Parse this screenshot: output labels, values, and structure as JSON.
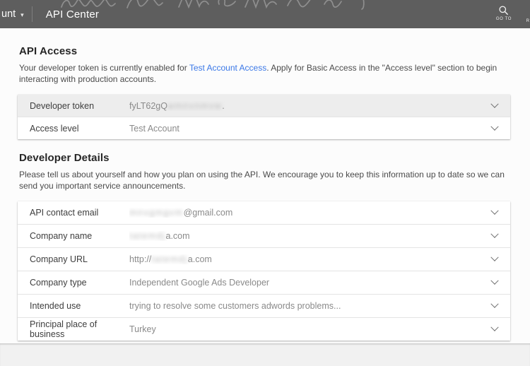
{
  "colors": {
    "header_bg": "#5e5e5e",
    "header_text": "#ffffff",
    "link_blue": "#3b78e7",
    "content_bg": "#fcfcfc",
    "footer_bg": "#f1f1f1",
    "shaded_row_bg": "#ededed",
    "row_bg": "#ffffff",
    "label_text": "#3e3e3e",
    "value_text": "#8a8a8a",
    "heading_text": "#262626",
    "body_text": "#4b4b4b"
  },
  "header": {
    "account_label": "unt",
    "caret_icon": "▾",
    "title": "API Center",
    "goto_label": "GO TO",
    "clipped_label": "R"
  },
  "sections": {
    "api_access": {
      "title": "API Access",
      "desc_before_link": "Your developer token is currently enabled for ",
      "desc_link": "Test Account Access",
      "desc_after_link": ". Apply for Basic Access in the \"Access level\" section to begin interacting with production accounts.",
      "rows": [
        {
          "label": "Developer token",
          "shaded": true,
          "parts": [
            {
              "text": "fyLT62gQ",
              "blur": false
            },
            {
              "text": "wmnvnmvw",
              "blur": true
            },
            {
              "text": ".",
              "blur": false
            }
          ]
        },
        {
          "label": "Access level",
          "shaded": false,
          "parts": [
            {
              "text": "Test Account",
              "blur": false
            }
          ]
        }
      ]
    },
    "developer_details": {
      "title": "Developer Details",
      "desc": "Please tell us about yourself and how you plan on using the API. We encourage you to keep this information up to date so we can send you important service announcements.",
      "rows": [
        {
          "label": "API contact email",
          "shaded": false,
          "parts": [
            {
              "text": "mnvgmgvm",
              "blur": true
            },
            {
              "text": "@gmail.com",
              "blur": false
            }
          ]
        },
        {
          "label": "Company name",
          "shaded": false,
          "parts": [
            {
              "text": "tatemdj",
              "blur": true
            },
            {
              "text": "a.com",
              "blur": false
            }
          ]
        },
        {
          "label": "Company URL",
          "shaded": false,
          "parts": [
            {
              "text": "http://",
              "blur": false
            },
            {
              "text": "tatemdj",
              "blur": true
            },
            {
              "text": "a.com",
              "blur": false
            }
          ]
        },
        {
          "label": "Company type",
          "shaded": false,
          "parts": [
            {
              "text": "Independent Google Ads Developer",
              "blur": false
            }
          ]
        },
        {
          "label": "Intended use",
          "shaded": false,
          "parts": [
            {
              "text": "trying to resolve some customers adwords problems...",
              "blur": false
            }
          ]
        },
        {
          "label": "Principal place of business",
          "shaded": false,
          "parts": [
            {
              "text": "Turkey",
              "blur": false
            }
          ]
        }
      ]
    }
  }
}
